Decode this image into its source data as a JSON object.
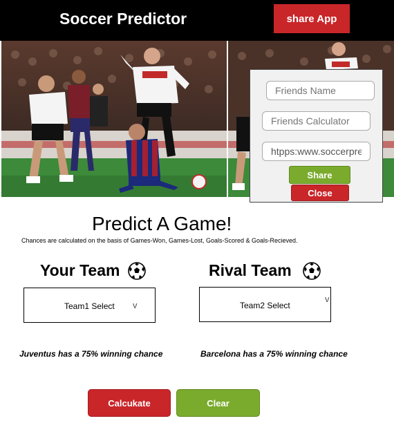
{
  "header": {
    "title": "Soccer Predictor",
    "share_app_label": "share App"
  },
  "share_popup": {
    "friends_name_placeholder": "Friends Name",
    "friends_calculator_placeholder": "Friends Calculator",
    "share_link_value": "htpps:www.soccerpre",
    "share_label": "Share",
    "close_label": "Close"
  },
  "main": {
    "heading": "Predict A Game!",
    "subtitle": "Chances are calculated on the basis of Games-Won, Games-Lost, Goals-Scored & Goals-Recieved.",
    "your_team_title": "Your Team",
    "rival_team_title": "Rival Team",
    "team1_select_label": "Team1 Select",
    "team2_select_label": "Team2 Select",
    "team1_chance": "Juventus has a 75% winning chance",
    "team2_chance": "Barcelona has a 75% winning chance",
    "calculate_label": "Calcukate",
    "clear_label": "Clear"
  },
  "icons": {
    "ball": "soccer-ball-icon",
    "chevron": "chevron-down-icon"
  },
  "colors": {
    "header_bg": "#000000",
    "accent_red": "#c9262a",
    "accent_green": "#7bab2d"
  }
}
